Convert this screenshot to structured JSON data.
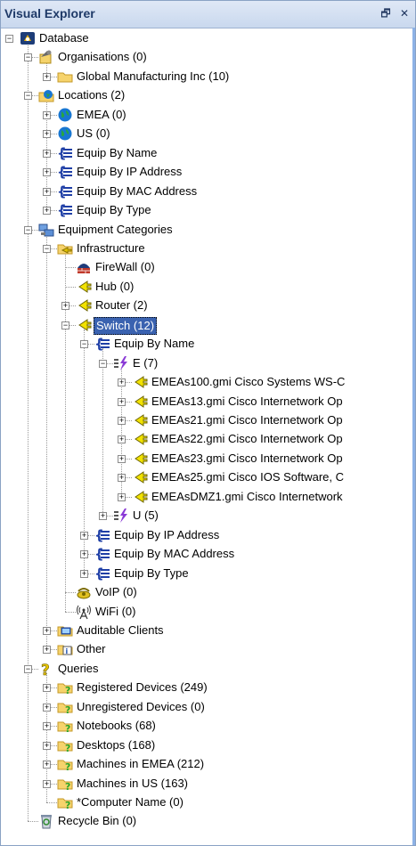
{
  "titlebar": {
    "title": "Visual Explorer",
    "pin_glyph": "🗗",
    "close_glyph": "✕"
  },
  "tree": {
    "nodes": [
      {
        "label": "Database",
        "icon": "database-icon"
      },
      {
        "label": "Organisations (0)",
        "icon": "organisations-icon"
      },
      {
        "label": "Global Manufacturing Inc (10)",
        "icon": "folder-icon"
      },
      {
        "label": "Locations (2)",
        "icon": "locations-icon"
      },
      {
        "label": "EMEA (0)",
        "icon": "globe-icon"
      },
      {
        "label": "US (0)",
        "icon": "globe-icon"
      },
      {
        "label": "Equip By Name",
        "icon": "list-icon"
      },
      {
        "label": "Equip By IP Address",
        "icon": "list-icon"
      },
      {
        "label": "Equip By MAC Address",
        "icon": "list-icon"
      },
      {
        "label": "Equip By Type",
        "icon": "list-icon"
      },
      {
        "label": "Equipment Categories",
        "icon": "equipment-categories-icon"
      },
      {
        "label": "Infrastructure",
        "icon": "infrastructure-icon"
      },
      {
        "label": "FireWall (0)",
        "icon": "firewall-icon"
      },
      {
        "label": "Hub (0)",
        "icon": "network-device-icon"
      },
      {
        "label": "Router (2)",
        "icon": "network-device-icon"
      },
      {
        "label": "Switch (12)",
        "icon": "network-device-icon",
        "selected": true
      },
      {
        "label": "Equip By Name",
        "icon": "list-icon"
      },
      {
        "label": "E (7)",
        "icon": "letter-group-icon"
      },
      {
        "label": "EMEAs100.gmi Cisco Systems WS-C",
        "icon": "network-device-icon"
      },
      {
        "label": "EMEAs13.gmi Cisco Internetwork Op",
        "icon": "network-device-icon"
      },
      {
        "label": "EMEAs21.gmi Cisco Internetwork Op",
        "icon": "network-device-icon"
      },
      {
        "label": "EMEAs22.gmi Cisco Internetwork Op",
        "icon": "network-device-icon"
      },
      {
        "label": "EMEAs23.gmi Cisco Internetwork Op",
        "icon": "network-device-icon"
      },
      {
        "label": "EMEAs25.gmi Cisco IOS Software, C",
        "icon": "network-device-icon"
      },
      {
        "label": "EMEAsDMZ1.gmi Cisco Internetwork",
        "icon": "network-device-icon"
      },
      {
        "label": "U (5)",
        "icon": "letter-group-icon"
      },
      {
        "label": "Equip By IP Address",
        "icon": "list-icon"
      },
      {
        "label": "Equip By MAC Address",
        "icon": "list-icon"
      },
      {
        "label": "Equip By Type",
        "icon": "list-icon"
      },
      {
        "label": "VoIP (0)",
        "icon": "voip-icon"
      },
      {
        "label": "WiFi (0)",
        "icon": "wifi-icon"
      },
      {
        "label": "Auditable Clients",
        "icon": "auditable-clients-icon"
      },
      {
        "label": "Other",
        "icon": "other-icon"
      },
      {
        "label": "Queries",
        "icon": "queries-icon"
      },
      {
        "label": "Registered Devices (249)",
        "icon": "query-folder-icon"
      },
      {
        "label": "Unregistered Devices (0)",
        "icon": "query-folder-icon"
      },
      {
        "label": "Notebooks (68)",
        "icon": "query-folder-icon"
      },
      {
        "label": "Desktops (168)",
        "icon": "query-folder-icon"
      },
      {
        "label": "Machines in EMEA (212)",
        "icon": "query-folder-icon"
      },
      {
        "label": "Machines in US (163)",
        "icon": "query-folder-icon"
      },
      {
        "label": "*Computer Name (0)",
        "icon": "query-folder-icon"
      },
      {
        "label": "Recycle Bin (0)",
        "icon": "recycle-bin-icon"
      }
    ]
  },
  "colors": {
    "selection": "#3a62b0",
    "title_text": "#1f3a68",
    "border": "#8aa2c4"
  }
}
